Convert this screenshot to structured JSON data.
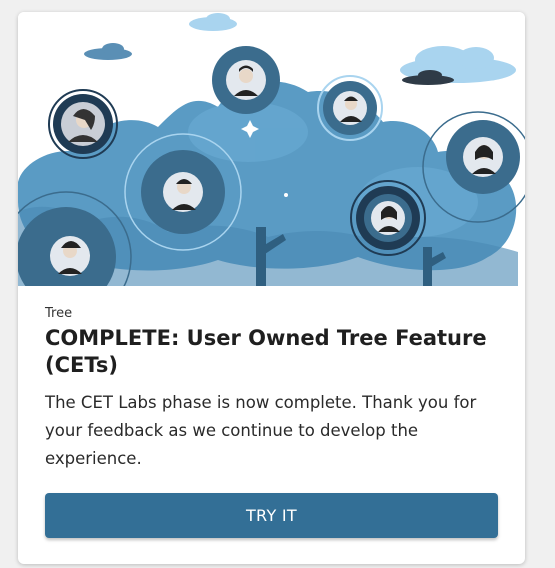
{
  "card": {
    "category": "Tree",
    "title": "COMPLETE: User Owned Tree Feature (CETs)",
    "description": "The CET Labs phase is now complete. Thank you for your feedback as we continue to develop the experience.",
    "button_label": "TRY IT"
  },
  "colors": {
    "accent": "#336f96",
    "tree_canopy": "#5a9bc4",
    "tree_dark": "#3b6c8d",
    "sky_cloud": "#a9d4ef"
  }
}
